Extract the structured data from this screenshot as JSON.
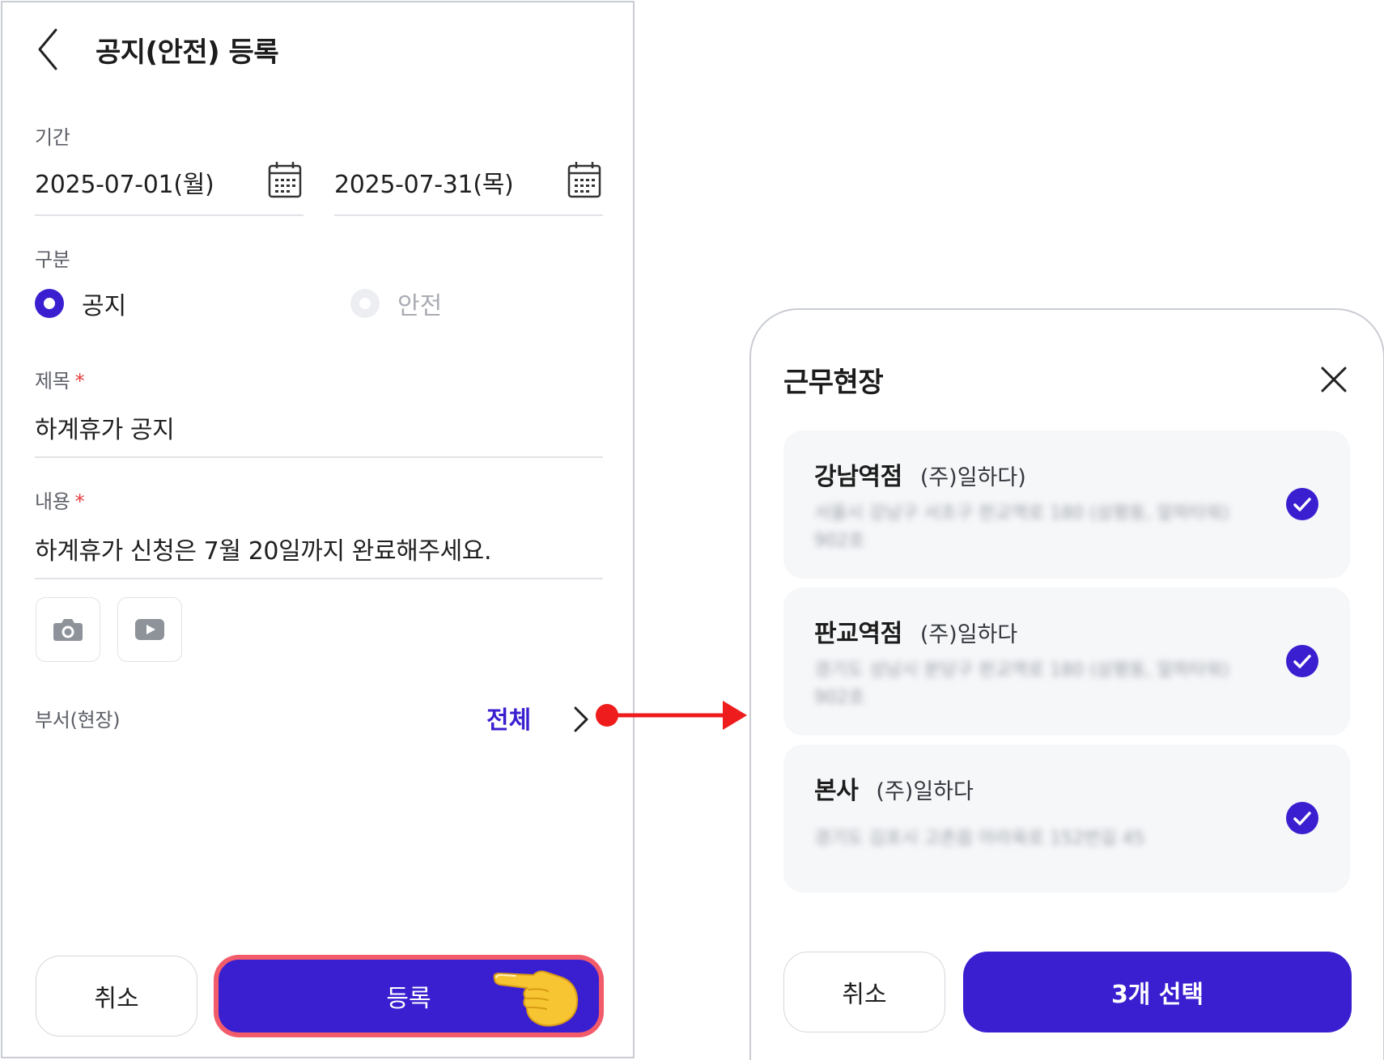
{
  "left_screen": {
    "title": "공지(안전) 등록",
    "period": {
      "label": "기간",
      "start_date": "2025-07-01(월)",
      "end_date": "2025-07-31(목)"
    },
    "category": {
      "label": "구분",
      "options": [
        {
          "label": "공지",
          "selected": true
        },
        {
          "label": "안전",
          "selected": false
        }
      ]
    },
    "subject": {
      "label": "제목",
      "required_mark": "*",
      "value": "하계휴가 공지"
    },
    "content": {
      "label": "내용",
      "required_mark": "*",
      "value": "하계휴가 신청은 7월 20일까지 완료해주세요."
    },
    "attachments": [
      {
        "icon": "camera-icon"
      },
      {
        "icon": "video-icon"
      }
    ],
    "department": {
      "label": "부서(현장)",
      "value": "전체"
    },
    "buttons": {
      "cancel": "취소",
      "submit": "등록"
    }
  },
  "site_sheet": {
    "title": "근무현장",
    "sites": [
      {
        "name": "강남역점",
        "company": "(주)일하다)",
        "address": "서울시 강남구 서초구 판교역로 180 (삼평동, 알파타워) 902호",
        "checked": true
      },
      {
        "name": "판교역점",
        "company": "(주)일하다",
        "address": "경기도 성남시 분당구 판교역로 180 (삼평동, 알파타워) 902호",
        "checked": true
      },
      {
        "name": "본사",
        "company": "(주)일하다",
        "address": "경기도 김포시 고촌읍 아라육로 152번길 45",
        "checked": true
      }
    ],
    "buttons": {
      "cancel": "취소",
      "confirm": "3개 선택"
    }
  },
  "colors": {
    "primary": "#3a1fd0",
    "highlight": "#f25b6a",
    "annotation_arrow": "#ee1c1c",
    "required": "#e53b3b"
  }
}
